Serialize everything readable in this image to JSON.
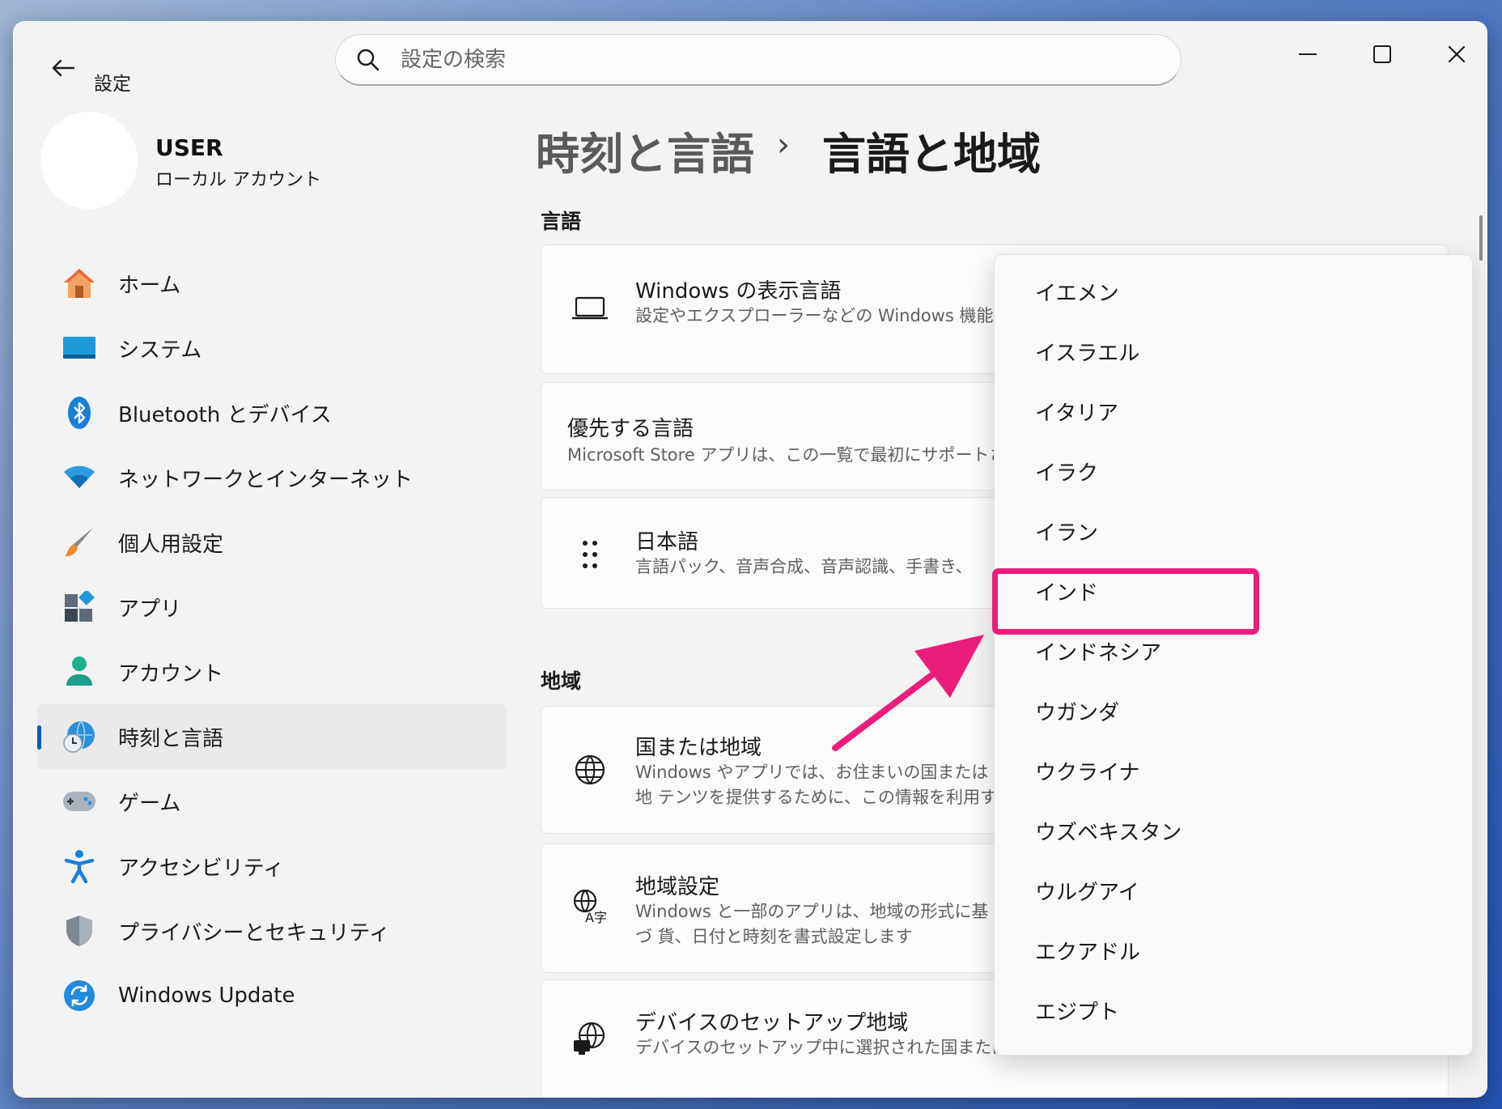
{
  "window": {
    "title": "設定",
    "search_placeholder": "設定の検索"
  },
  "profile": {
    "name": "USER",
    "account_type": "ローカル アカウント"
  },
  "sidebar": {
    "items": [
      {
        "label": "ホーム",
        "icon": "home-icon"
      },
      {
        "label": "システム",
        "icon": "system-icon"
      },
      {
        "label": "Bluetooth とデバイス",
        "icon": "bluetooth-icon"
      },
      {
        "label": "ネットワークとインターネット",
        "icon": "wifi-icon"
      },
      {
        "label": "個人用設定",
        "icon": "brush-icon"
      },
      {
        "label": "アプリ",
        "icon": "apps-icon"
      },
      {
        "label": "アカウント",
        "icon": "account-icon"
      },
      {
        "label": "時刻と言語",
        "icon": "time-language-icon",
        "active": true
      },
      {
        "label": "ゲーム",
        "icon": "gamepad-icon"
      },
      {
        "label": "アクセシビリティ",
        "icon": "accessibility-icon"
      },
      {
        "label": "プライバシーとセキュリティ",
        "icon": "shield-icon"
      },
      {
        "label": "Windows Update",
        "icon": "update-icon"
      }
    ]
  },
  "breadcrumb": {
    "parent": "時刻と言語",
    "separator": "›",
    "current": "言語と地域"
  },
  "sections": {
    "language": {
      "title": "言語",
      "cards": [
        {
          "title": "Windows の表示言語",
          "desc": "設定やエクスプローラーなどの Windows 機能は す。"
        },
        {
          "title": "優先する言語",
          "desc": "Microsoft Store アプリは、この一覧で最初にサポートされ"
        },
        {
          "title": "日本語",
          "desc": "言語パック、音声合成、音声認識、手書き、"
        }
      ]
    },
    "region": {
      "title": "地域",
      "cards": [
        {
          "title": "国または地域",
          "desc": "Windows やアプリでは、お住まいの国または地 テンツを提供するために、この情報を利用すること"
        },
        {
          "title": "地域設定",
          "desc": "Windows と一部のアプリは、地域の形式に基づ 貨、日付と時刻を書式設定します"
        },
        {
          "title": "デバイスのセットアップ地域",
          "desc": "デバイスのセットアップ中に選択された国または地域"
        }
      ]
    }
  },
  "country_dropdown": {
    "items": [
      "イエメン",
      "イスラエル",
      "イタリア",
      "イラク",
      "イラン",
      "インド",
      "インドネシア",
      "ウガンダ",
      "ウクライナ",
      "ウズベキスタン",
      "ウルグアイ",
      "エクアドル",
      "エジプト"
    ],
    "highlighted": "インド"
  },
  "colors": {
    "annotation": "#ea1e7a",
    "accent": "#005fb8"
  }
}
